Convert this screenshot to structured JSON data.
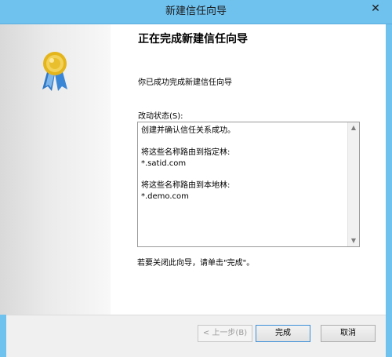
{
  "window": {
    "title": "新建信任向导",
    "close_glyph": "✕"
  },
  "content": {
    "heading": "正在完成新建信任向导",
    "description": "你已成功完成新建信任向导",
    "status_label": "改动状态(S):",
    "status_text": "创建并确认信任关系成功。\n\n将这些名称路由到指定林:\n*.satid.com\n\n将这些名称路由到本地林:\n*.demo.com",
    "close_hint": "若要关闭此向导，请单击\"完成\"。"
  },
  "scrollbar": {
    "up_glyph": "▲",
    "down_glyph": "▼"
  },
  "buttons": {
    "back": "< 上一步(B)",
    "finish": "完成",
    "cancel": "取消"
  },
  "colors": {
    "titlebar": "#6fc1ee",
    "medal_gold": "#e5b51c",
    "ribbon_blue": "#2e78c8"
  },
  "icons": {
    "medal": "award-medal-icon"
  }
}
